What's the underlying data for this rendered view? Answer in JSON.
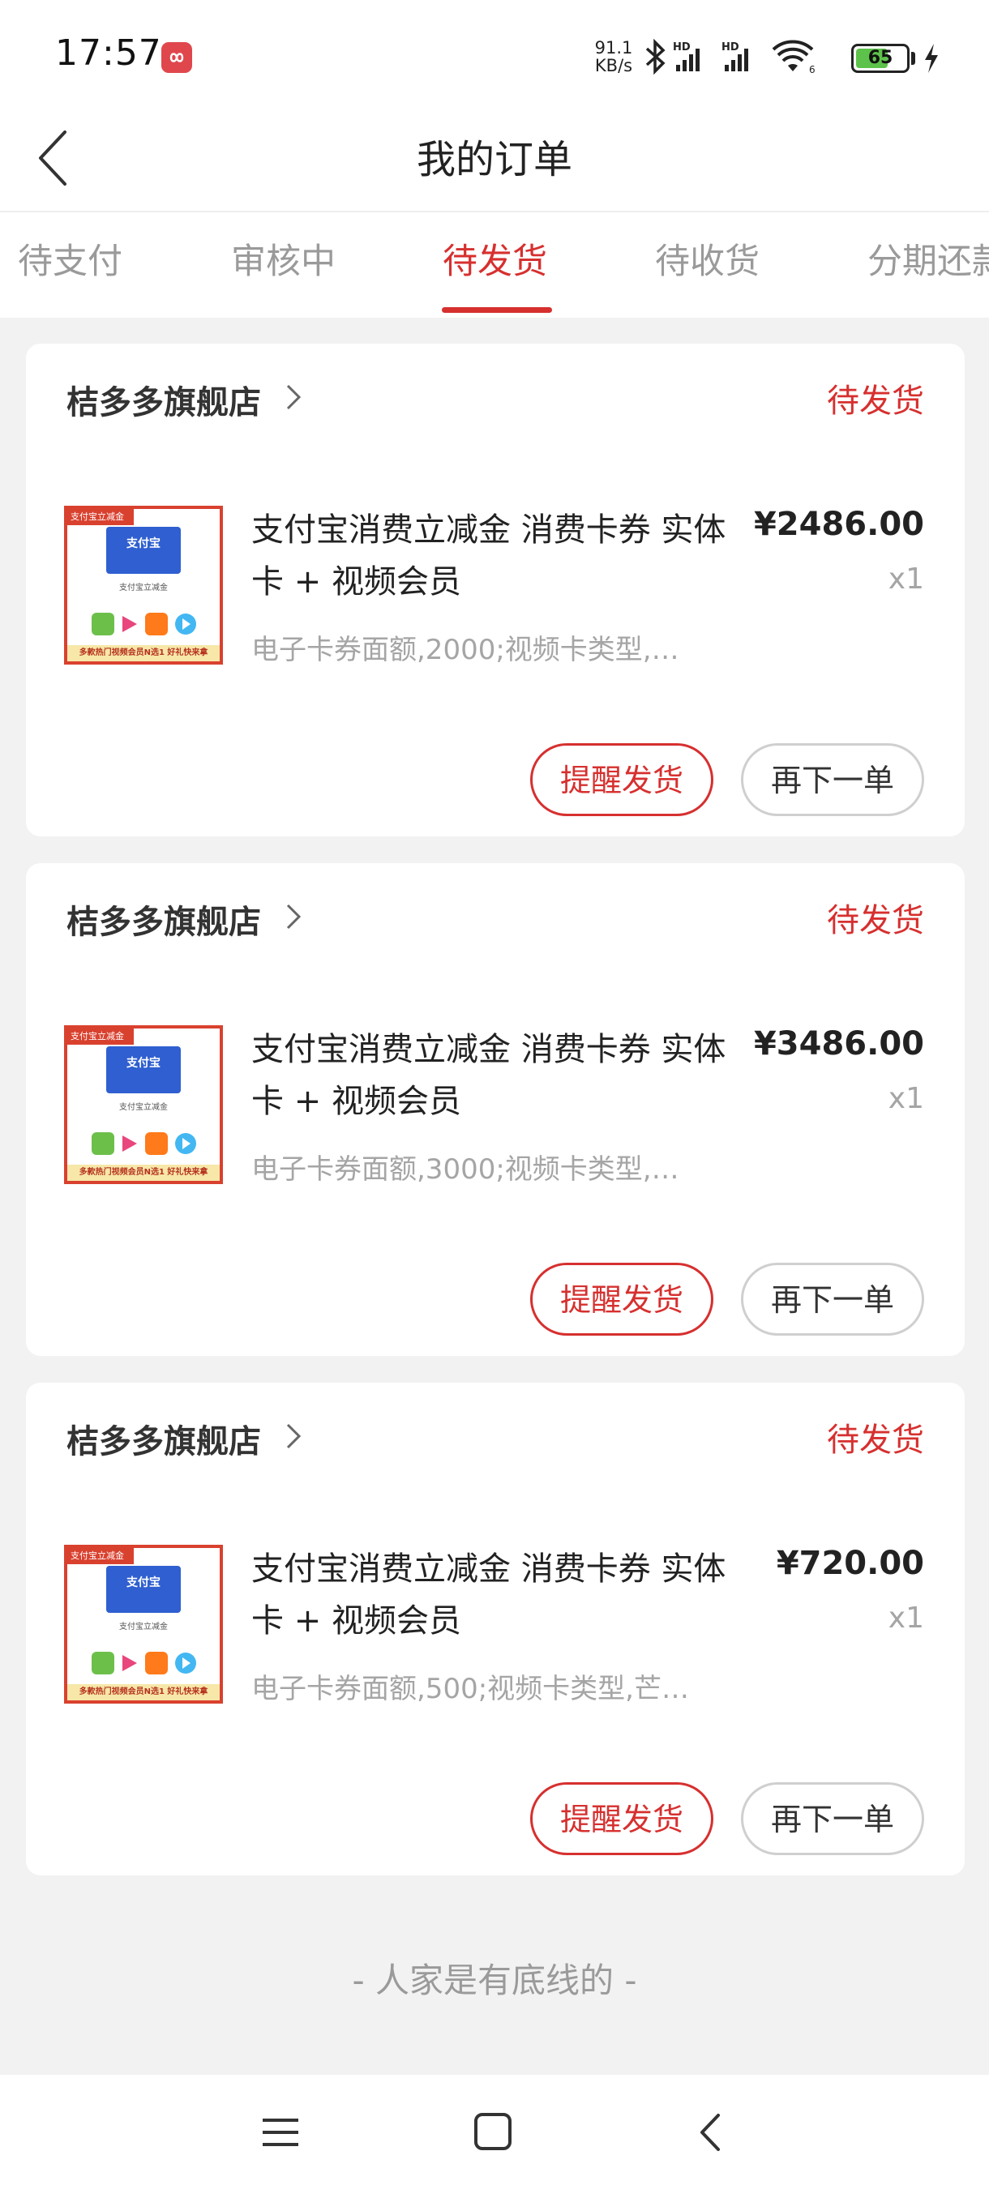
{
  "status_bar": {
    "time": "17:57",
    "net_speed_value": "91.1",
    "net_speed_unit": "KB/s",
    "battery": "65",
    "battery_level": 0.65,
    "icons": [
      "infinity-app-icon",
      "bluetooth-icon",
      "hd-signal-icon",
      "hd-signal-icon",
      "wifi-icon",
      "battery-icon",
      "charging-icon"
    ]
  },
  "header": {
    "title": "我的订单"
  },
  "tabs": [
    {
      "label": "待支付",
      "active": false
    },
    {
      "label": "审核中",
      "active": false
    },
    {
      "label": "待发货",
      "active": true
    },
    {
      "label": "待收货",
      "active": false
    },
    {
      "label": "分期还款",
      "active": false
    }
  ],
  "orders": [
    {
      "store": "桔多多旗舰店",
      "status": "待发货",
      "title": "支付宝消费立减金 消费卡券 实体卡 + 视频会员",
      "spec": "电子卡券面额,2000;视频卡类型,…",
      "price": "¥2486.00",
      "qty": "x1",
      "remind_label": "提醒发货",
      "reorder_label": "再下一单"
    },
    {
      "store": "桔多多旗舰店",
      "status": "待发货",
      "title": "支付宝消费立减金 消费卡券 实体卡 + 视频会员",
      "spec": "电子卡券面额,3000;视频卡类型,…",
      "price": "¥3486.00",
      "qty": "x1",
      "remind_label": "提醒发货",
      "reorder_label": "再下一单"
    },
    {
      "store": "桔多多旗舰店",
      "status": "待发货",
      "title": "支付宝消费立减金 消费卡券 实体卡 + 视频会员",
      "spec": "电子卡券面额,500;视频卡类型,芒…",
      "price": "¥720.00",
      "qty": "x1",
      "remind_label": "提醒发货",
      "reorder_label": "再下一单"
    }
  ],
  "thumb": {
    "tag": "支付宝立减金",
    "card_text": "支付宝",
    "label": "支付宝立减金",
    "foot": "多款热门视频会员N选1 好礼快来拿"
  },
  "footer_note": "- 人家是有底线的 -",
  "colors": {
    "accent": "#d6302f",
    "background": "#f2f2f2",
    "muted_text": "#a5a5a5"
  }
}
